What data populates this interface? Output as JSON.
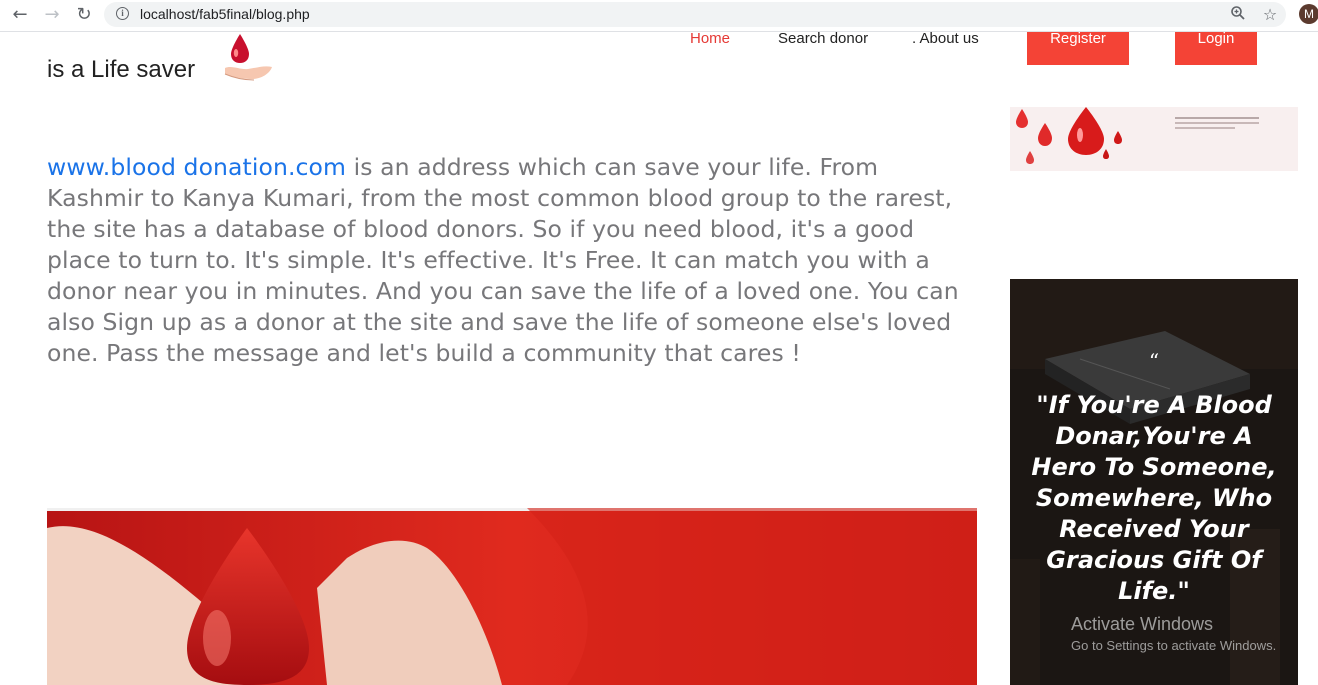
{
  "browser": {
    "url": "localhost/fab5final/blog.php",
    "profile_initial": "M"
  },
  "header": {
    "brand_text": "is a Life saver",
    "nav": {
      "home": "Home",
      "search": "Search donor",
      "about": ". About us",
      "register": "Register",
      "login": "Login"
    }
  },
  "article": {
    "link_text": "www.blood donation.com",
    "body": " is an address which can save your life. From Kashmir to Kanya Kumari, from the most common blood group to the rarest, the site has a database of blood donors. So if you need blood, it's a good place to turn to. It's simple. It's effective. It's Free. It can match you with a donor near you in minutes. And you can save the life of a loved one. You can also Sign up as a donor at the site and save the life of someone else's loved one. Pass the message and let's build a community that cares !"
  },
  "sidebar": {
    "quote_mark": "“",
    "quote": "\"If You're A Blood Donar,You're A Hero To Someone, Somewhere, Who Received Your Gracious Gift Of Life.\""
  },
  "watermark": {
    "line1": "Activate Windows",
    "line2": "Go to Settings to activate Windows."
  },
  "colors": {
    "accent": "#f44336",
    "link": "#1a73e8",
    "body_text": "#77777a"
  }
}
